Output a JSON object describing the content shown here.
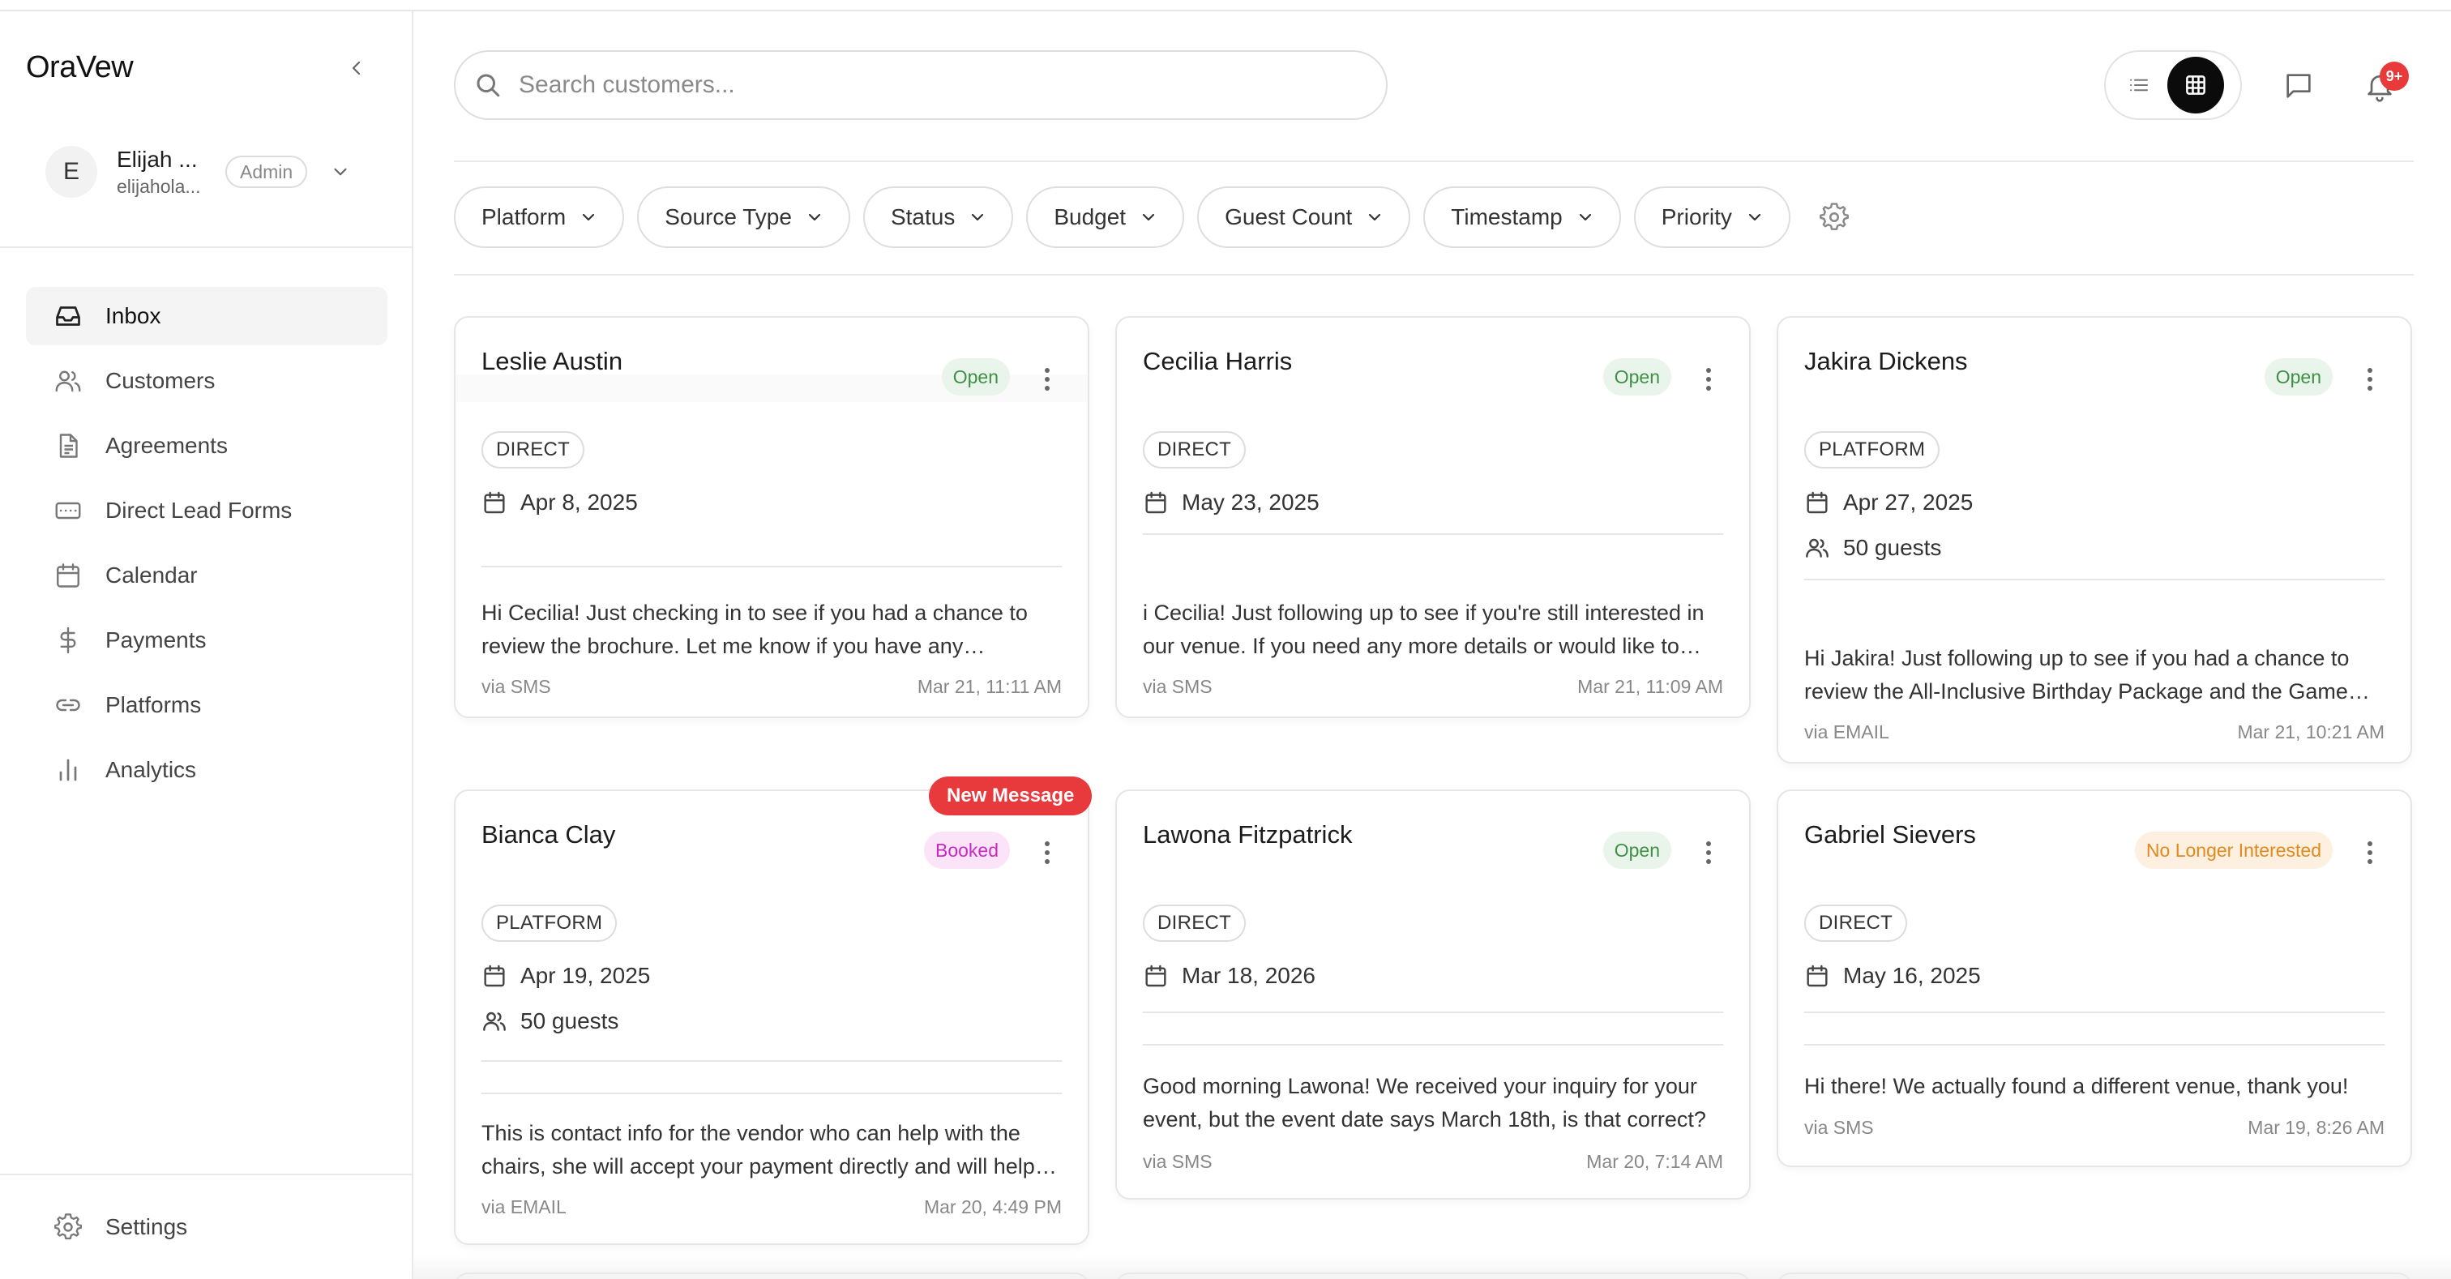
{
  "colors": {
    "open_bg": "#e9f5ea",
    "open_text": "#3f8f46",
    "booked_bg": "#fbe4f8",
    "booked_text": "#c72bc0",
    "nli_bg": "#fdf0e0",
    "nli_text": "#e08a1e",
    "new_message": "#e8393d",
    "badge": "#e83a3a"
  },
  "sidebar": {
    "brand": "OraVew",
    "user": {
      "initial": "E",
      "name": "Elijah ...",
      "email": "elijahola...",
      "role": "Admin"
    },
    "items": [
      {
        "label": "Inbox",
        "icon": "inbox-icon",
        "active": true
      },
      {
        "label": "Customers",
        "icon": "users-icon"
      },
      {
        "label": "Agreements",
        "icon": "file-text-icon"
      },
      {
        "label": "Direct Lead Forms",
        "icon": "form-icon"
      },
      {
        "label": "Calendar",
        "icon": "calendar-icon"
      },
      {
        "label": "Payments",
        "icon": "dollar-icon"
      },
      {
        "label": "Platforms",
        "icon": "link-icon"
      },
      {
        "label": "Analytics",
        "icon": "bar-chart-icon"
      }
    ],
    "settings_label": "Settings"
  },
  "search": {
    "placeholder": "Search customers..."
  },
  "notifications": {
    "badge": "9+"
  },
  "filters": [
    "Platform",
    "Source Type",
    "Status",
    "Budget",
    "Guest Count",
    "Timestamp",
    "Priority"
  ],
  "cards": [
    {
      "name": "Leslie Austin",
      "status": "Open",
      "source": "DIRECT",
      "date": "Apr 8, 2025",
      "guests": "",
      "message": "Hi Cecilia! Just checking in to see if you had a chance to review the brochure. Let me know if you have any questions!",
      "via": "via SMS",
      "time": "Mar 21, 11:11 AM",
      "new_message": ""
    },
    {
      "name": "Cecilia Harris",
      "status": "Open",
      "source": "DIRECT",
      "date": "May 23, 2025",
      "guests": "",
      "message": "i Cecilia! Just following up to see if you're still interested in our venue. If you need any more details or would like to schedule a tour, let me know!",
      "via": "via SMS",
      "time": "Mar 21, 11:09 AM",
      "new_message": ""
    },
    {
      "name": "Jakira Dickens",
      "status": "Open",
      "source": "PLATFORM",
      "date": "Apr 27, 2025",
      "guests": "50 guests",
      "message": "Hi Jakira! Just following up to see if you had a chance to review the All-Inclusive Birthday Package and the Game Room options.",
      "via": "via EMAIL",
      "time": "Mar 21, 10:21 AM",
      "new_message": ""
    },
    {
      "name": "Bianca Clay",
      "status": "Booked",
      "source": "PLATFORM",
      "date": "Apr 19, 2025",
      "guests": "50 guests",
      "message": "This is contact info for the vendor who can help with the chairs, she will accept your payment directly and will help you out.",
      "via": "via EMAIL",
      "time": "Mar 20, 4:49 PM",
      "new_message": "New Message"
    },
    {
      "name": "Lawona Fitzpatrick",
      "status": "Open",
      "source": "DIRECT",
      "date": "Mar 18, 2026",
      "guests": "",
      "message": "Good morning Lawona! We received your inquiry for your event, but the event date says March 18th, is that correct?",
      "via": "via SMS",
      "time": "Mar 20, 7:14 AM",
      "new_message": ""
    },
    {
      "name": "Gabriel Sievers",
      "status": "No Longer Interested",
      "source": "DIRECT",
      "date": "May 16, 2025",
      "guests": "",
      "message": "Hi there! We actually found a different venue, thank you!",
      "via": "via SMS",
      "time": "Mar 19, 8:26 AM",
      "new_message": ""
    }
  ]
}
